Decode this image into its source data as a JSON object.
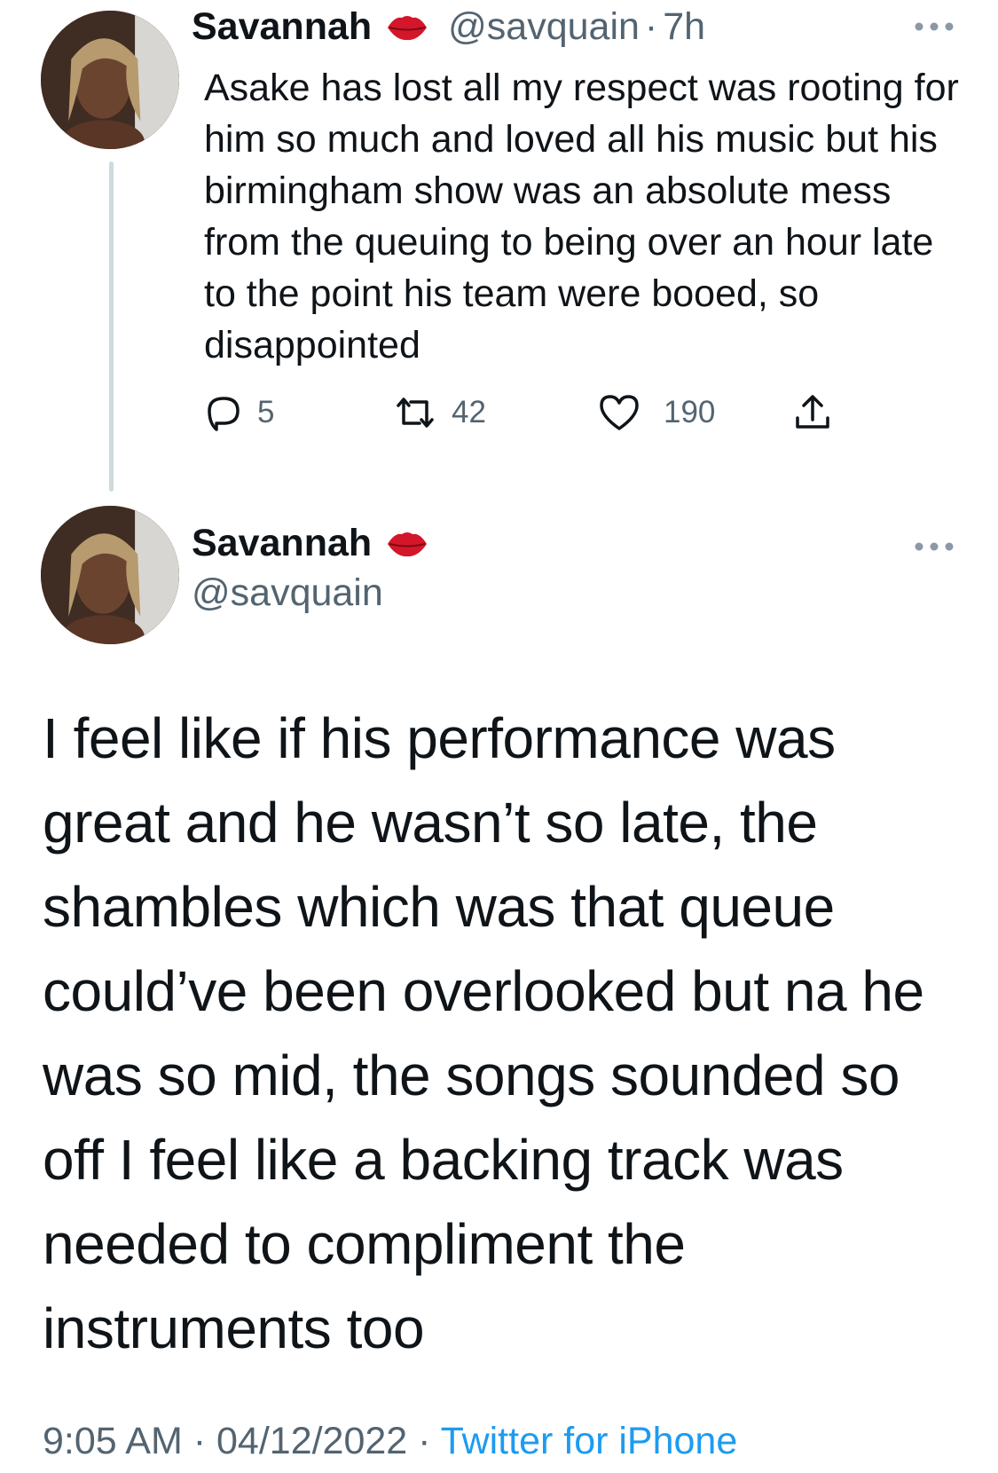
{
  "tweets": [
    {
      "author_name": "Savannah",
      "badge_emoji": "💋",
      "handle": "@savquain",
      "separator": "·",
      "time": "7h",
      "text": "Asake has lost all my respect was rooting for him so much and loved all his music but his birmingham show was an absolute mess from the queuing to being over an hour late to the point his team were booed, so disappointed",
      "actions": {
        "replies": "5",
        "retweets": "42",
        "likes": "190"
      }
    },
    {
      "author_name": "Savannah",
      "badge_emoji": "💋",
      "handle": "@savquain",
      "text": "I feel like if his performance was great and he wasn’t so late, the shambles which was that queue could’ve been overlooked but na he was so mid, the songs sounded so off I feel like a backing track was needed to compliment the instruments too",
      "meta": {
        "time": "9:05 AM",
        "dot1": "·",
        "date": "04/12/2022",
        "dot2": "·",
        "source": "Twitter for iPhone"
      }
    }
  ],
  "icons": {
    "more": "more-icon",
    "reply": "reply-icon",
    "retweet": "retweet-icon",
    "like": "heart-icon",
    "share": "share-icon",
    "badge": "lips-icon"
  },
  "colors": {
    "text": "#0f1419",
    "secondary": "#536471",
    "link": "#1d9bf0",
    "thread_line": "#cfd9de",
    "badge": "#d4162a"
  }
}
